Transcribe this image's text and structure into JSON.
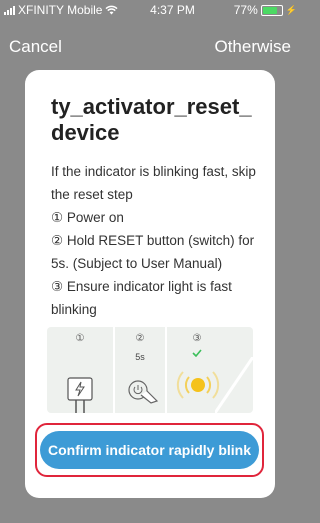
{
  "status_bar": {
    "carrier": "XFINITY Mobile",
    "time": "4:37 PM",
    "battery": "77%",
    "battery_level": 0.77,
    "battery_color": "#4cd964"
  },
  "nav": {
    "cancel": "Cancel",
    "otherwise": "Otherwise"
  },
  "card": {
    "title": "ty_activator_reset_device",
    "lines": [
      "If the indicator is blinking fast, skip the reset step",
      "① Power on",
      "② Hold RESET button (switch) for 5s. (Subject to User Manual)",
      "③ Ensure indicator light is fast blinking"
    ],
    "illustration": {
      "steps": [
        "①",
        "②",
        "③"
      ],
      "step2_label": "5s",
      "check_color": "#3bbf5a",
      "light_color": "#f5c21b"
    },
    "confirm_button": "Confirm indicator rapidly blink",
    "accent": "#3d9bd6",
    "highlight": "#e0253b"
  }
}
